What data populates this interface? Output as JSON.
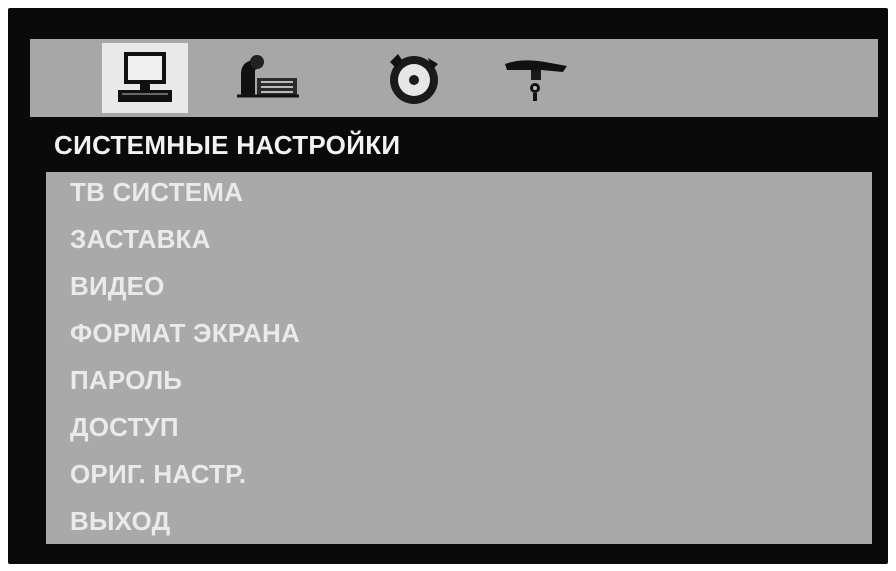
{
  "toolbar": {
    "tabs": [
      {
        "icon": "computer-monitor-icon",
        "active": true
      },
      {
        "icon": "language-icon",
        "active": false
      },
      {
        "icon": "audio-icon",
        "active": false
      },
      {
        "icon": "preferences-icon",
        "active": false
      }
    ]
  },
  "section_title": "СИСТЕМНЫЕ НАСТРОЙКИ",
  "menu": {
    "items": [
      "ТВ СИСТЕМА",
      "ЗАСТАВКА",
      "ВИДЕО",
      "ФОРМАТ ЭКРАНА",
      "ПАРОЛЬ",
      "ДОСТУП",
      "ОРИГ. НАСТР.",
      "ВЫХОД"
    ]
  },
  "colors": {
    "background": "#0a0a0a",
    "toolbar": "#a7a7a7",
    "active_tab": "#e9e9e9",
    "panel": "#a9a9a9",
    "text": "#eaeaea"
  }
}
